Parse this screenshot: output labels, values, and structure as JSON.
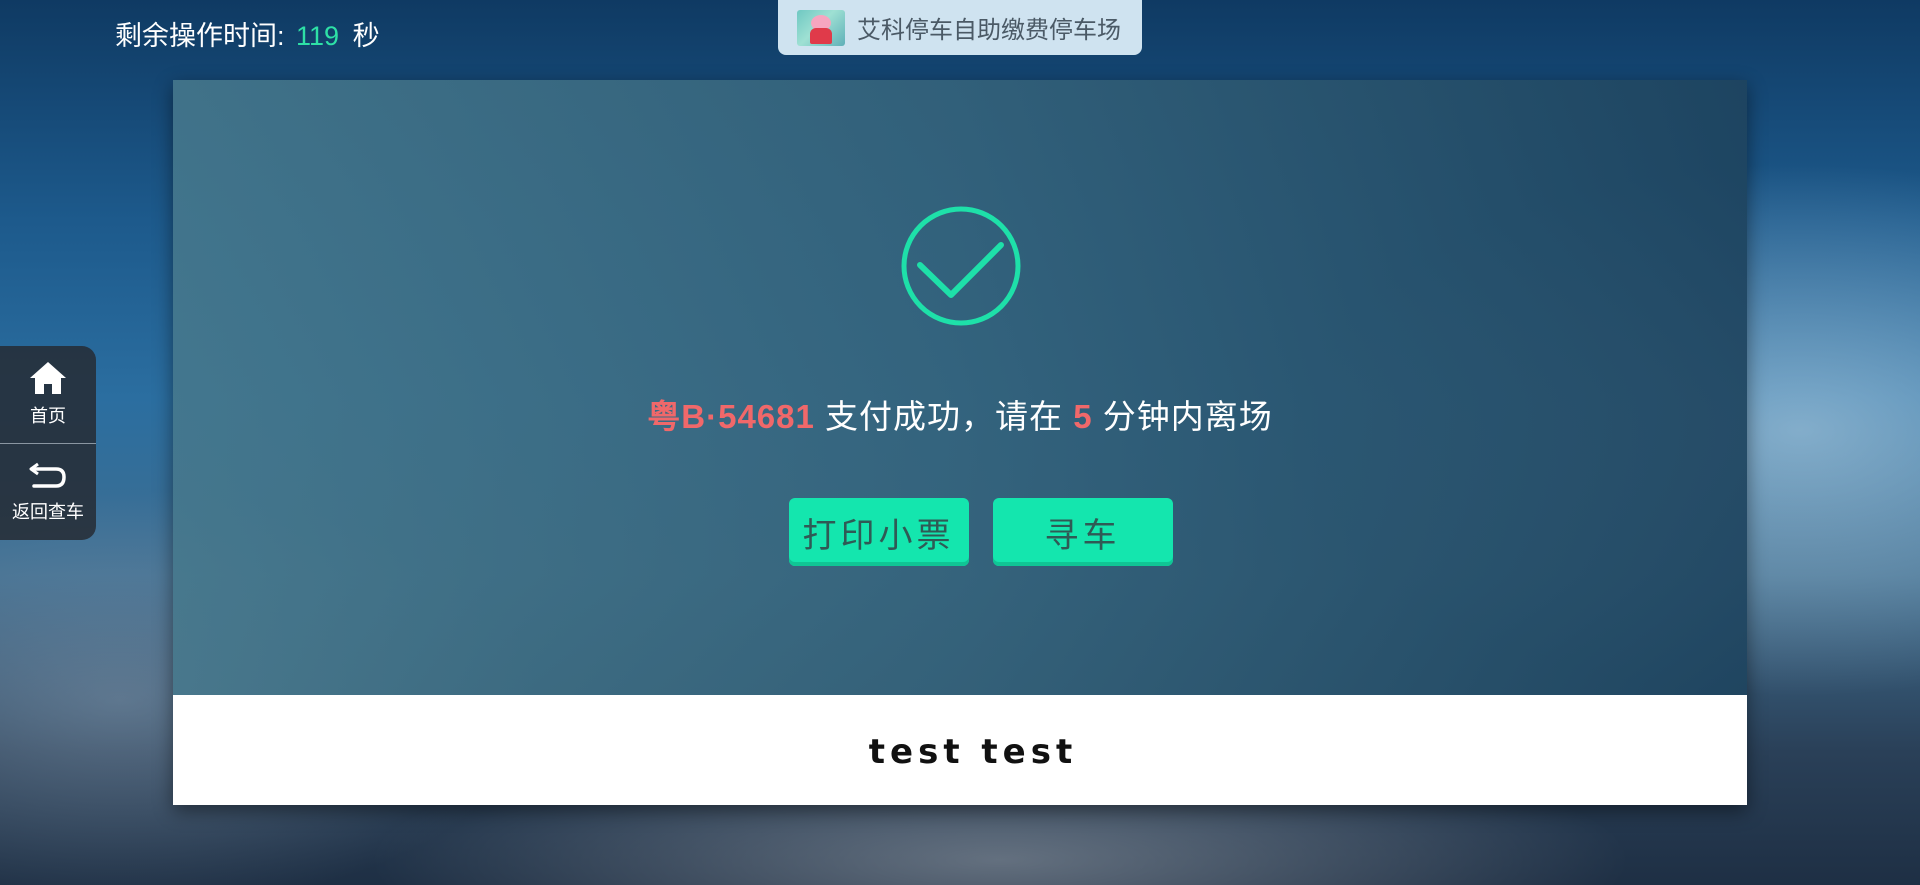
{
  "header": {
    "countdown_label": "剩余操作时间:",
    "countdown_value": "119",
    "countdown_unit": "秒",
    "countdown_value_color": "#2ee0a6"
  },
  "lot": {
    "name": "艾科停车自助缴费停车场",
    "logo_icon": "peppa-pig-logo"
  },
  "sidebar": {
    "items": [
      {
        "label": "首页",
        "icon": "home-icon"
      },
      {
        "label": "返回查车",
        "icon": "back-arrow-icon"
      }
    ]
  },
  "result": {
    "status_icon": "check-circle-icon",
    "plate": "粤B·54681",
    "msg_before_minutes": "支付成功，请在",
    "minutes": "5",
    "msg_after_minutes": "分钟内离场",
    "highlight_color": "#f0686a",
    "accent_color": "#14e6ae"
  },
  "actions": {
    "print_receipt": "打印小票",
    "find_car": "寻车"
  },
  "footer": {
    "text": "test test"
  }
}
